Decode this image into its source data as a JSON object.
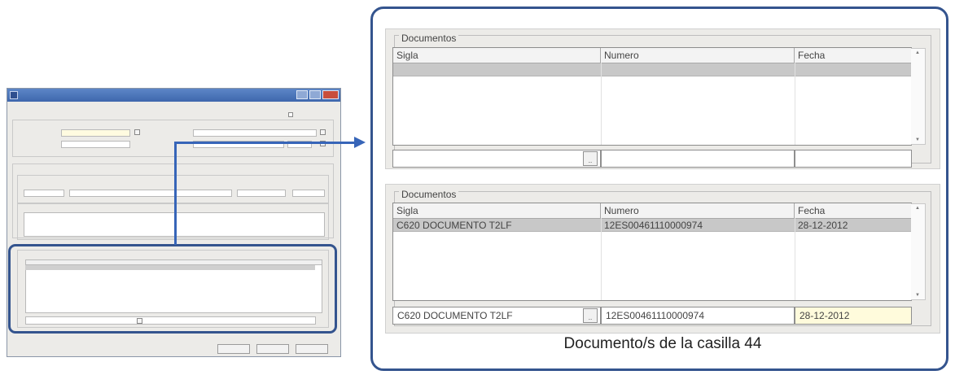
{
  "zoom_top": {
    "legend": "Documentos",
    "columns": [
      "Sigla",
      "Numero",
      "Fecha"
    ],
    "rows": [],
    "inputs": {
      "sigla": "",
      "numero": "",
      "fecha": ""
    },
    "dots_label": "..."
  },
  "zoom_bottom": {
    "legend": "Documentos",
    "columns": [
      "Sigla",
      "Numero",
      "Fecha"
    ],
    "rows": [
      {
        "sigla": "C620 DOCUMENTO T2LF",
        "numero": "12ES00461110000974",
        "fecha": "28-12-2012"
      }
    ],
    "inputs": {
      "sigla": "C620 DOCUMENTO T2LF",
      "numero": "12ES00461110000974",
      "fecha": "28-12-2012"
    },
    "dots_label": "..."
  },
  "caption": "Documento/s de la casilla 44",
  "colors": {
    "highlight": "#34548e",
    "connector": "#3765b8",
    "selected_row": "#c8c8c8",
    "date_field": "#fffbdc"
  }
}
